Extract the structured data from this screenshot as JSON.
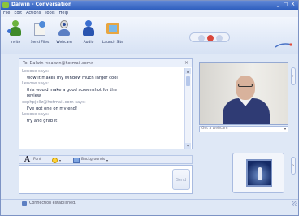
{
  "window": {
    "title": "Dalwin - Conversation",
    "min": "_",
    "max": "□",
    "close": "X"
  },
  "menu": [
    "File",
    "Edit",
    "Actions",
    "Tools",
    "Help"
  ],
  "toolbar": {
    "items": [
      {
        "label": "Invite",
        "icon": "invite-icon"
      },
      {
        "label": "Send Files",
        "icon": "send-files-icon"
      },
      {
        "label": "Webcam",
        "icon": "webcam-icon"
      },
      {
        "label": "Audio",
        "icon": "audio-icon"
      },
      {
        "label": "Launch Site",
        "icon": "launch-site-icon"
      }
    ],
    "brand": "msn"
  },
  "conversation": {
    "to_line": "To: Dalwin <dalwin@hotmail.com>",
    "close_glyph": "×",
    "lines": [
      {
        "kind": "who",
        "text": "Lenose says:"
      },
      {
        "kind": "said",
        "text": "wow it makes my window much larger cool"
      },
      {
        "kind": "who",
        "text": "Lenose says:"
      },
      {
        "kind": "said",
        "text": "this would make a good screenshot for the"
      },
      {
        "kind": "said",
        "text": "review"
      },
      {
        "kind": "who",
        "text": "cephpjellz@hotmail.com says:"
      },
      {
        "kind": "said",
        "text": "I've got one on my end!"
      },
      {
        "kind": "who",
        "text": "Lenose says:"
      },
      {
        "kind": "said",
        "text": "try and grab it"
      }
    ]
  },
  "webcam": {
    "dropdown_label": "Get a webcam"
  },
  "format": {
    "a_glyph": "A",
    "font_label": "Font",
    "bg_label": "Backgrounds",
    "arrow": "▾"
  },
  "input": {
    "send_label": "Send",
    "value": ""
  },
  "status": {
    "text": "Connection established."
  },
  "scroll": {
    "up": "▲",
    "down": "▼"
  },
  "side_toggle": "›",
  "colors": {
    "accent": "#2f5fbf",
    "panel": "#dfe8f6"
  }
}
